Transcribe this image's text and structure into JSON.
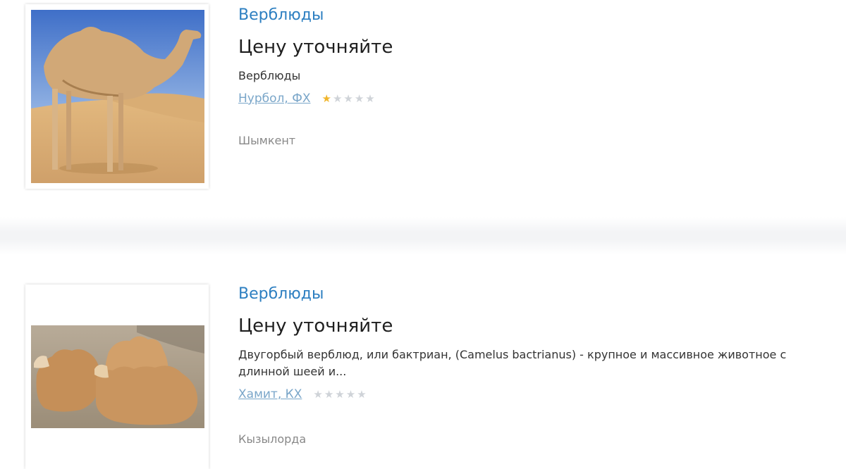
{
  "listings": [
    {
      "category": "Верблюды",
      "price": "Цену уточняйте",
      "description": "Верблюды",
      "seller": "Нурбол, ФХ",
      "rating": 1,
      "rating_max": 5,
      "city": "Шымкент"
    },
    {
      "category": "Верблюды",
      "price": "Цену уточняйте",
      "description": "Двугорбый верблюд, или бактриан, (Camelus bactrianus) - крупное и массивное животное с длинной шеей и...",
      "seller": "Хамит, КХ",
      "rating": 0,
      "rating_max": 5,
      "city": "Кызылорда"
    }
  ],
  "colors": {
    "link": "#2d7fc1",
    "seller_link": "#7aa6c9",
    "star_on": "#f0b52b",
    "star_off": "#cfd3d8"
  }
}
